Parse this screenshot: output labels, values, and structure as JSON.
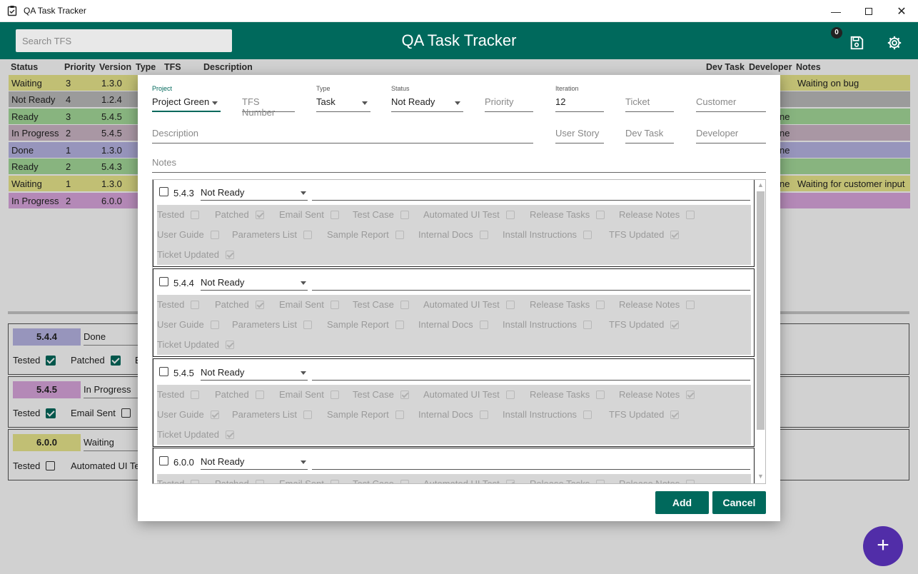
{
  "window": {
    "title": "QA Task Tracker"
  },
  "header": {
    "search_placeholder": "Search TFS",
    "title": "QA Task Tracker",
    "badge_count": "0"
  },
  "columns": [
    "Status",
    "Priority",
    "Version",
    "Type",
    "TFS",
    "Description",
    "Dev Task",
    "Developer",
    "Notes"
  ],
  "rows": [
    {
      "status": "Waiting",
      "priority": "3",
      "version": "1.3.0",
      "developer": "",
      "notes": "Waiting on bug",
      "color": "#ece98e"
    },
    {
      "status": "Not Ready",
      "priority": "4",
      "version": "1.2.4",
      "developer": "",
      "notes": "",
      "color": "#bdbdbd"
    },
    {
      "status": "Ready",
      "priority": "3",
      "version": "5.4.5",
      "developer": "ne",
      "notes": "",
      "color": "#a6dc9b"
    },
    {
      "status": "In Progress",
      "priority": "2",
      "version": "5.4.5",
      "developer": "ne",
      "notes": "",
      "color": "#cfb9c8"
    },
    {
      "status": "Done",
      "priority": "1",
      "version": "1.3.0",
      "developer": "ne",
      "notes": "",
      "color": "#b9b6e6"
    },
    {
      "status": "Ready",
      "priority": "2",
      "version": "5.4.3",
      "developer": "",
      "notes": "",
      "color": "#a6dc9b"
    },
    {
      "status": "Waiting",
      "priority": "1",
      "version": "1.3.0",
      "developer": "ne",
      "notes": "Waiting for customer input",
      "color": "#ece98e"
    },
    {
      "status": "In Progress",
      "priority": "2",
      "version": "6.0.0",
      "developer": "",
      "notes": "",
      "color": "#dca8e0"
    }
  ],
  "bottom_cards": [
    {
      "version": "5.4.4",
      "status": "Done",
      "color": "#b9b6e6",
      "checks": [
        {
          "label": "Tested",
          "checked": true
        },
        {
          "label": "Patched",
          "checked": true
        },
        {
          "label": "E",
          "checked": null
        }
      ]
    },
    {
      "version": "5.4.5",
      "status": "In Progress",
      "color": "#dca8e0",
      "checks": [
        {
          "label": "Tested",
          "checked": true
        },
        {
          "label": "Email Sent",
          "checked": false
        }
      ]
    },
    {
      "version": "6.0.0",
      "status": "Waiting",
      "color": "#ece98e",
      "checks": [
        {
          "label": "Tested",
          "checked": false
        },
        {
          "label": "Automated UI Te",
          "checked": null
        }
      ]
    }
  ],
  "dialog": {
    "project": {
      "label": "Project",
      "value": "Project Green"
    },
    "tfs_number": {
      "placeholder": "TFS Number"
    },
    "type": {
      "label": "Type",
      "value": "Task"
    },
    "status": {
      "label": "Status",
      "value": "Not Ready"
    },
    "priority": {
      "placeholder": "Priority"
    },
    "iteration": {
      "label": "Iteration",
      "value": "12"
    },
    "ticket": {
      "placeholder": "Ticket"
    },
    "customer": {
      "placeholder": "Customer"
    },
    "description": {
      "placeholder": "Description"
    },
    "user_story": {
      "placeholder": "User Story"
    },
    "dev_task": {
      "placeholder": "Dev Task"
    },
    "developer": {
      "placeholder": "Developer"
    },
    "notes": {
      "placeholder": "Notes"
    },
    "add_label": "Add",
    "cancel_label": "Cancel"
  },
  "version_items": [
    {
      "version": "5.4.3",
      "status": "Not Ready",
      "checks": {
        "Tested": false,
        "Patched": true,
        "Email Sent": false,
        "Test Case": false,
        "Automated UI Test": false,
        "Release Tasks": false,
        "Release Notes": false,
        "User Guide": false,
        "Parameters List": false,
        "Sample Report": false,
        "Internal Docs": false,
        "Install Instructions": false,
        "TFS Updated": true,
        "Ticket Updated": true
      }
    },
    {
      "version": "5.4.4",
      "status": "Not Ready",
      "checks": {
        "Tested": false,
        "Patched": true,
        "Email Sent": false,
        "Test Case": false,
        "Automated UI Test": false,
        "Release Tasks": false,
        "Release Notes": false,
        "User Guide": false,
        "Parameters List": false,
        "Sample Report": false,
        "Internal Docs": false,
        "Install Instructions": false,
        "TFS Updated": true,
        "Ticket Updated": true
      }
    },
    {
      "version": "5.4.5",
      "status": "Not Ready",
      "checks": {
        "Tested": false,
        "Patched": false,
        "Email Sent": false,
        "Test Case": true,
        "Automated UI Test": false,
        "Release Tasks": false,
        "Release Notes": true,
        "User Guide": true,
        "Parameters List": false,
        "Sample Report": false,
        "Internal Docs": false,
        "Install Instructions": false,
        "TFS Updated": true,
        "Ticket Updated": true
      }
    },
    {
      "version": "6.0.0",
      "status": "Not Ready",
      "checks": {
        "Tested": false,
        "Patched": false,
        "Email Sent": false,
        "Test Case": false,
        "Automated UI Test": true,
        "Release Tasks": false,
        "Release Notes": false
      }
    }
  ]
}
